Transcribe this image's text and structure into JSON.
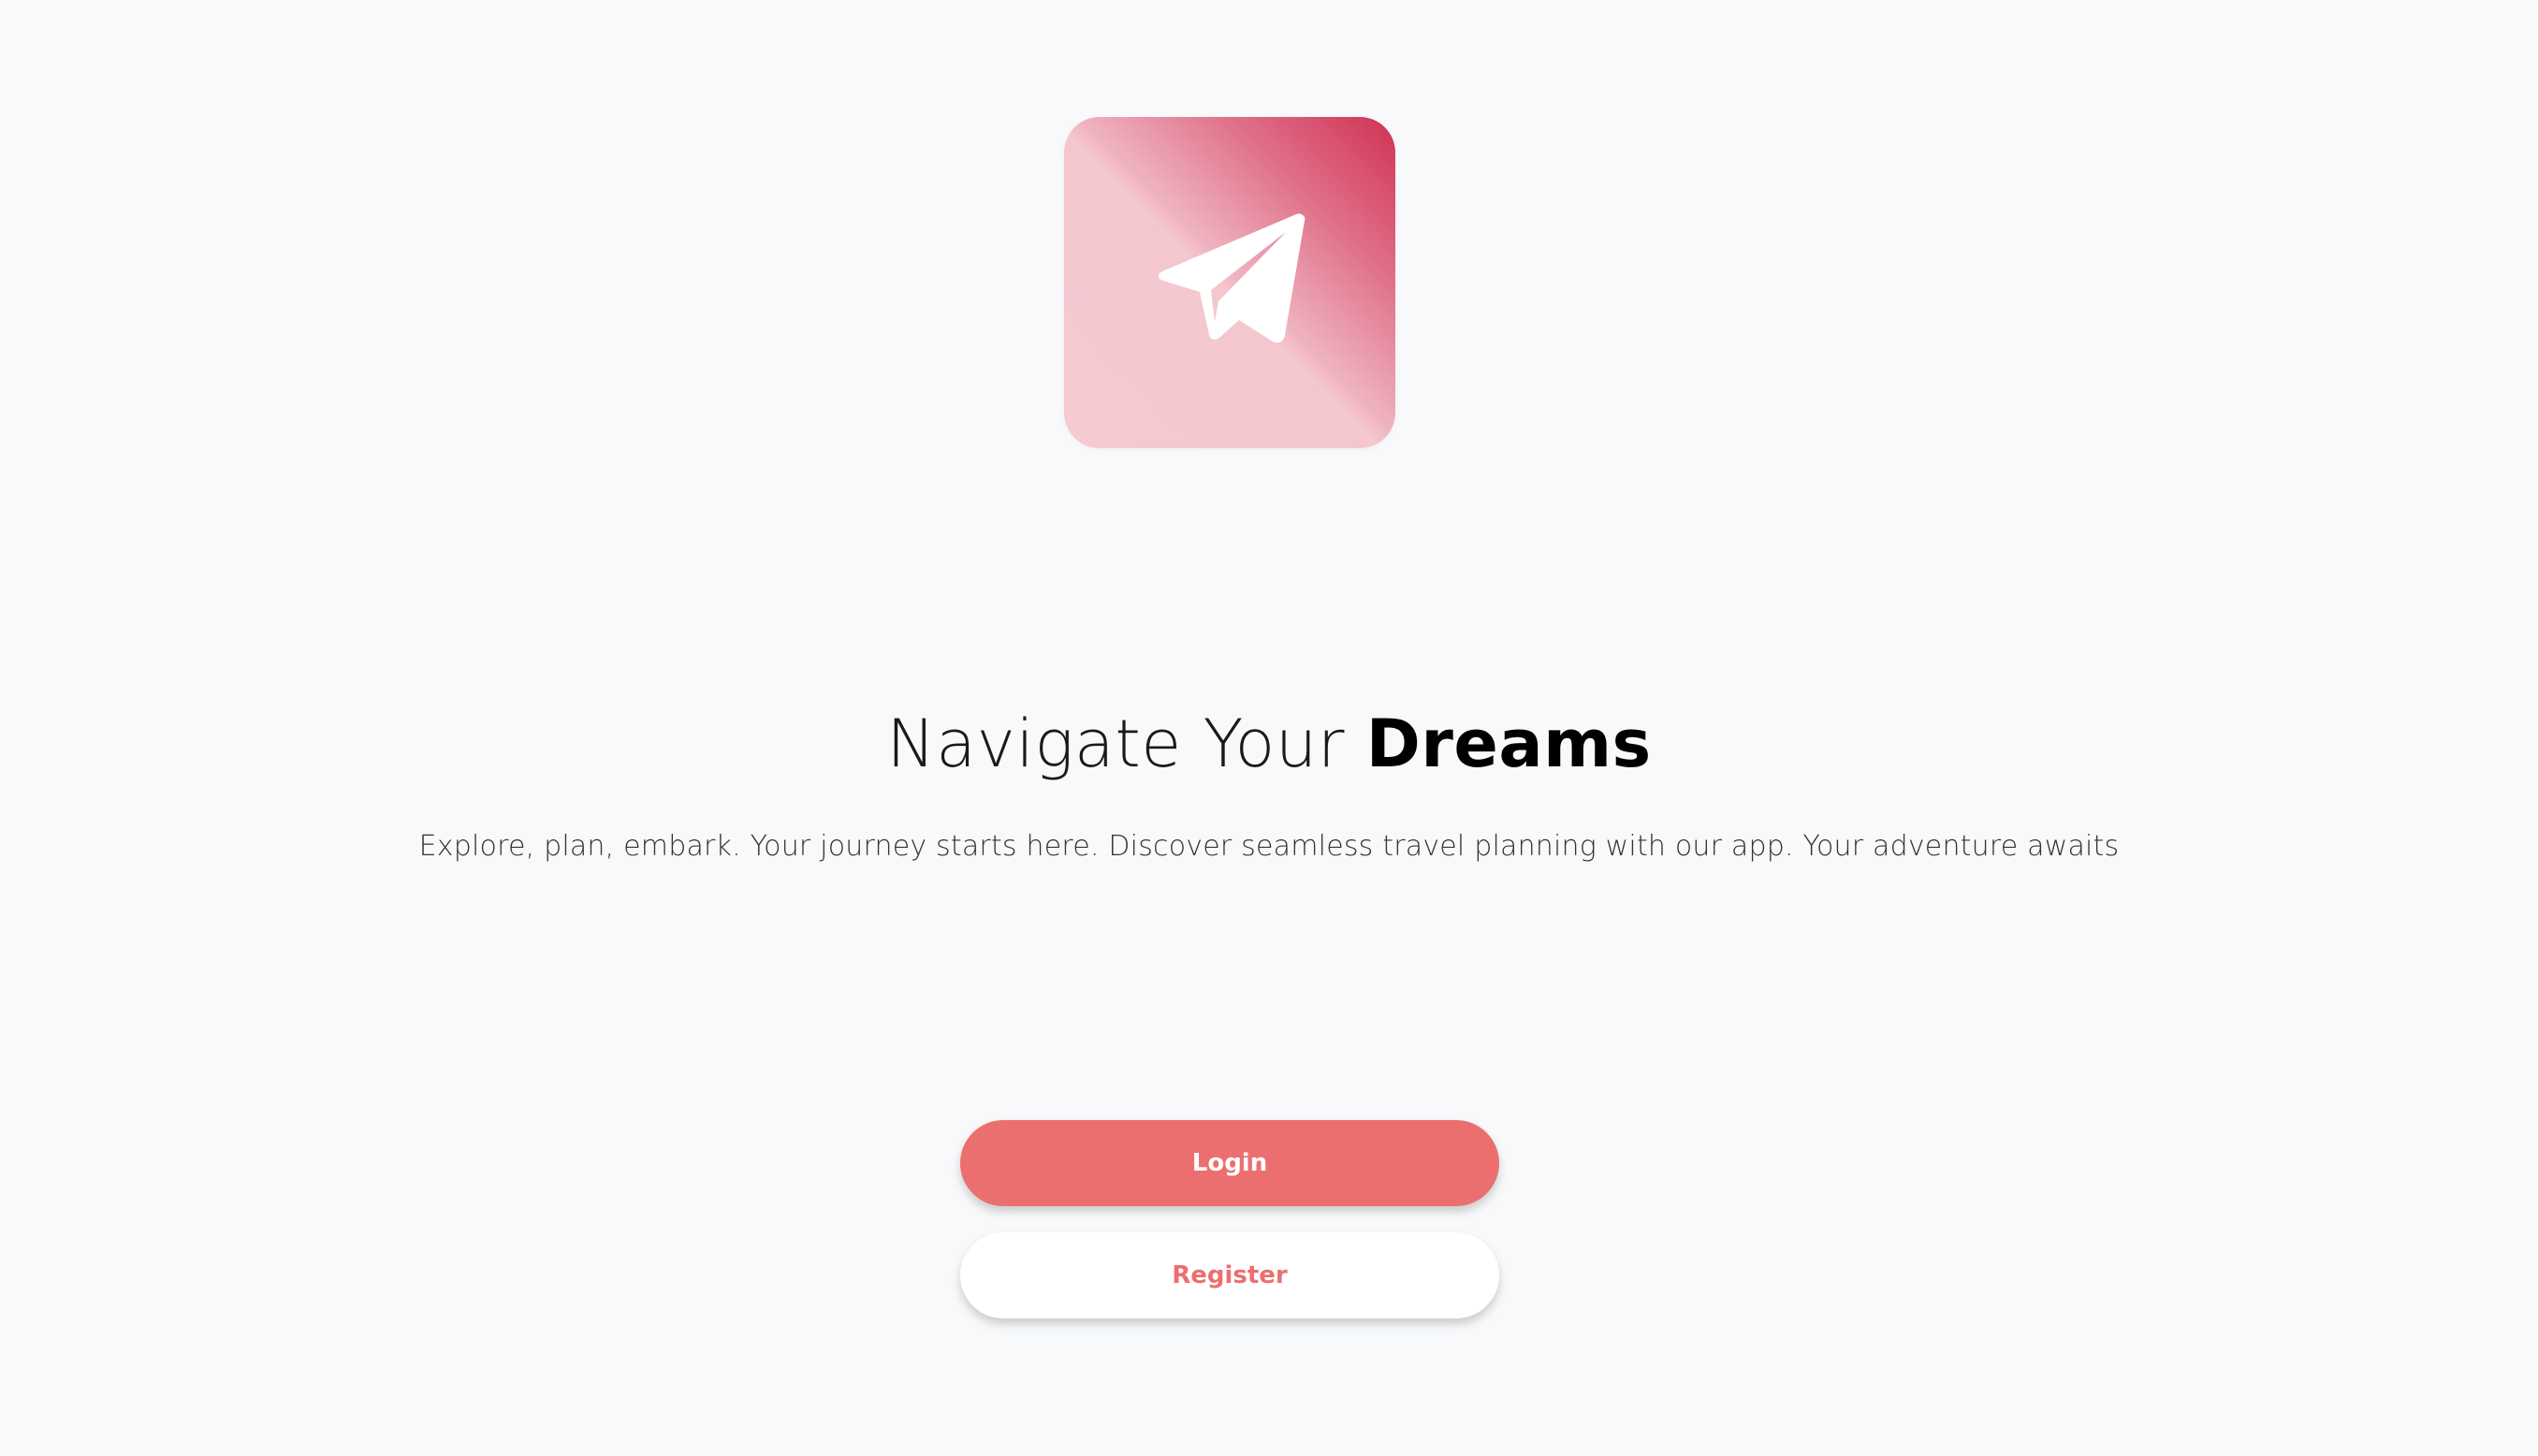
{
  "brand": {
    "logo_icon": "paper-plane-icon",
    "gradient_colors": [
      "#d03254",
      "#f5cad1"
    ],
    "icon_color": "#ffffff"
  },
  "hero": {
    "title_light": "Navigate Your ",
    "title_bold": "Dreams",
    "tagline": "Explore, plan, embark. Your journey starts here. Discover seamless travel planning with our app. Your adventure awaits"
  },
  "actions": {
    "login_label": "Login",
    "register_label": "Register",
    "accent_color": "#ec6f6f"
  }
}
